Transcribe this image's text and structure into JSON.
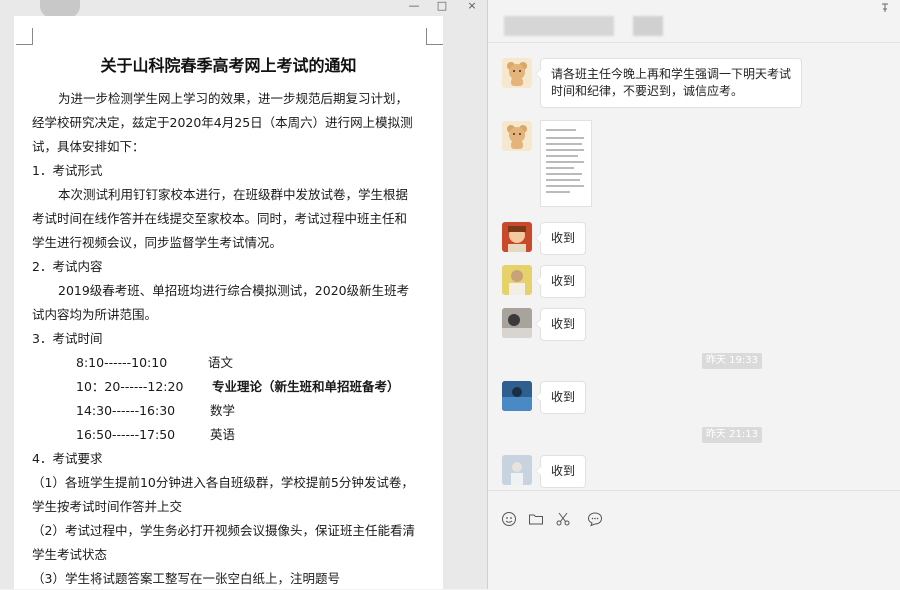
{
  "doc": {
    "window_controls": [
      "—",
      "□",
      "×"
    ],
    "title": "关于山科院春季高考网上考试的通知",
    "lines": [
      "为进一步检测学生网上学习的效果，进一步规范后期复习计划，",
      "经学校研究决定，兹定于2020年4月25日（本周六）进行网上模拟测",
      "试，具体安排如下：",
      "1．考试形式",
      "本次测试利用钉钉家校本进行，在班级群中发放试卷，学生根据",
      "考试时间在线作答并在线提交至家校本。同时，考试过程中班主任和",
      "学生进行视频会议，同步监督学生考试情况。",
      "2．考试内容",
      "2019级春考班、单招班均进行综合模拟测试，2020级新生班考",
      "试内容均为所讲范围。",
      "3．考试时间",
      "4．考试要求",
      "（1）各班学生提前10分钟进入各自班级群，学校提前5分钟发试卷，",
      "学生按考试时间作答并上交",
      "（2）考试过程中，学生务必打开视频会议摄像头，保证班主任能看清",
      "学生考试状态",
      "（3）学生将试题答案工整写在一张空白纸上，注明题号"
    ],
    "schedule": [
      {
        "time": "8:10------10:10",
        "subject": "语文"
      },
      {
        "time": "10：20------12:20",
        "subject": "专业理论（新生班和单招班备考）"
      },
      {
        "time": "14:30------16:30",
        "subject": "数学"
      },
      {
        "time": "16:50------17:50",
        "subject": "英语"
      }
    ]
  },
  "chat": {
    "pin_icon": "pin-icon",
    "messages": [
      {
        "type": "text",
        "text": "请各班主任今晚上再和学生强调一下明天考试\n时间和纪律，不要迟到，诚信应考。"
      },
      {
        "type": "image"
      },
      {
        "type": "text",
        "text": "收到"
      },
      {
        "type": "text",
        "text": "收到"
      },
      {
        "type": "text",
        "text": "收到"
      },
      {
        "type": "time",
        "text": "昨天 19:33"
      },
      {
        "type": "text",
        "text": "收到"
      },
      {
        "type": "time",
        "text": "昨天 21:13"
      },
      {
        "type": "text",
        "text": "收到"
      }
    ],
    "toolbar": [
      "emoji-icon",
      "folder-icon",
      "scissors-icon",
      "chat-history-icon"
    ]
  }
}
